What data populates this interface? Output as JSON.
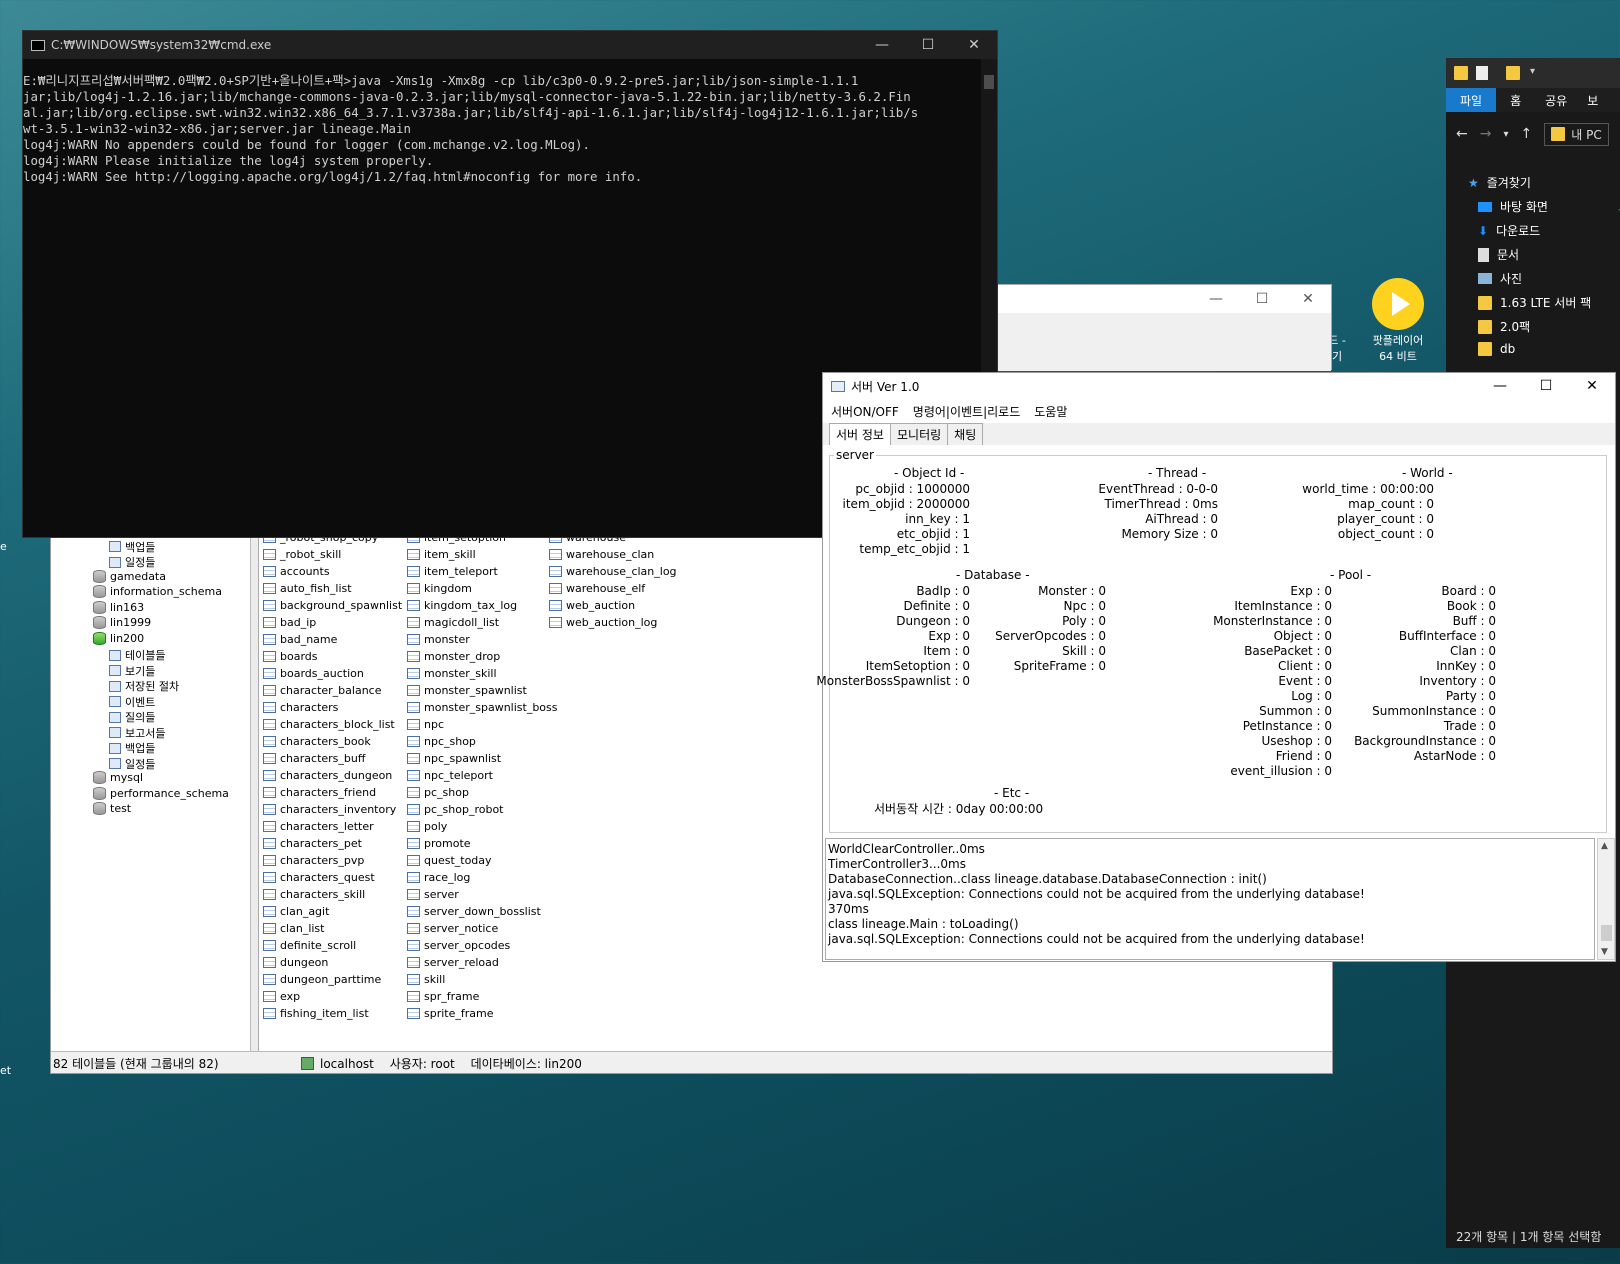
{
  "desktop": {
    "frag1": "e",
    "frag2": "et",
    "icon_label1": "팟플레이어",
    "icon_label2": "64 비트",
    "icon_label3": "드 -",
    "icon_label4": "기"
  },
  "cmd": {
    "title": "C:₩WINDOWS₩system32₩cmd.exe",
    "lines": [
      "E:₩리니지프리섭₩서버팩₩2.0팩₩2.0+SP기반+올나이트+팩>java -Xms1g -Xmx8g -cp lib/c3p0-0.9.2-pre5.jar;lib/json-simple-1.1.1",
      "jar;lib/log4j-1.2.16.jar;lib/mchange-commons-java-0.2.3.jar;lib/mysql-connector-java-5.1.22-bin.jar;lib/netty-3.6.2.Fin",
      "al.jar;lib/org.eclipse.swt.win32.win32.x86_64_3.7.1.v3738a.jar;lib/slf4j-api-1.6.1.jar;lib/slf4j-log4j12-1.6.1.jar;lib/s",
      "wt-3.5.1-win32-win32-x86.jar;server.jar lineage.Main",
      "log4j:WARN No appenders could be found for logger (com.mchange.v2.log.MLog).",
      "log4j:WARN Please initialize the log4j system properly.",
      "log4j:WARN See http://logging.apache.org/log4j/1.2/faq.html#noconfig for more info."
    ]
  },
  "mysql": {
    "tree": [
      {
        "label": "보고서들",
        "type": "report"
      },
      {
        "label": "백업들",
        "type": "backup"
      },
      {
        "label": "일정들",
        "type": "schedule"
      },
      {
        "label": "gamedata",
        "type": "db"
      },
      {
        "label": "information_schema",
        "type": "db"
      },
      {
        "label": "lin163",
        "type": "db"
      },
      {
        "label": "lin1999",
        "type": "db"
      },
      {
        "label": "lin200",
        "type": "db-open"
      },
      {
        "label": "테이블들",
        "type": "tables"
      },
      {
        "label": "보기들",
        "type": "views"
      },
      {
        "label": "저장된 절차",
        "type": "proc"
      },
      {
        "label": "이벤트",
        "type": "event"
      },
      {
        "label": "질의들",
        "type": "query"
      },
      {
        "label": "보고서들",
        "type": "report"
      },
      {
        "label": "백업들",
        "type": "backup"
      },
      {
        "label": "일정들",
        "type": "schedule"
      },
      {
        "label": "mysql",
        "type": "db"
      },
      {
        "label": "performance_schema",
        "type": "db"
      },
      {
        "label": "test",
        "type": "db"
      }
    ],
    "col1": [
      "_robot_shop_copy",
      "_robot_skill",
      "accounts",
      "auto_fish_list",
      "background_spawnlist",
      "bad_ip",
      "bad_name",
      "boards",
      "boards_auction",
      "character_balance",
      "characters",
      "characters_block_list",
      "characters_book",
      "characters_buff",
      "characters_dungeon",
      "characters_friend",
      "characters_inventory",
      "characters_letter",
      "characters_pet",
      "characters_pvp",
      "characters_quest",
      "characters_skill",
      "clan_agit",
      "clan_list",
      "definite_scroll",
      "dungeon",
      "dungeon_parttime",
      "exp",
      "fishing_item_list"
    ],
    "col2": [
      "item_setoption",
      "item_skill",
      "item_teleport",
      "kingdom",
      "kingdom_tax_log",
      "magicdoll_list",
      "monster",
      "monster_drop",
      "monster_skill",
      "monster_spawnlist",
      "monster_spawnlist_boss",
      "npc",
      "npc_shop",
      "npc_spawnlist",
      "npc_teleport",
      "pc_shop",
      "pc_shop_robot",
      "poly",
      "promote",
      "quest_today",
      "race_log",
      "server",
      "server_down_bosslist",
      "server_notice",
      "server_opcodes",
      "server_reload",
      "skill",
      "spr_frame",
      "sprite_frame"
    ],
    "col3": [
      "warehouse",
      "warehouse_clan",
      "warehouse_clan_log",
      "warehouse_elf",
      "web_auction",
      "web_auction_log"
    ],
    "status_count": "82 테이블들 (현재 그룹내의 82)",
    "status_host": "localhost",
    "status_user": "사용자: root",
    "status_db": "데이타베이스: lin200"
  },
  "server": {
    "title": "서버  Ver 1.0",
    "menu": [
      "서버ON/OFF",
      "명령어|이벤트|리로드",
      "도움말"
    ],
    "tabs": [
      "서버 정보",
      "모니터링",
      "채팅"
    ],
    "group": "server",
    "objectid_title": "- Object Id -",
    "objectid": [
      [
        "pc_objid",
        "1000000"
      ],
      [
        "item_objid",
        "2000000"
      ],
      [
        "inn_key",
        "1"
      ],
      [
        "etc_objid",
        "1"
      ],
      [
        "temp_etc_objid",
        "1"
      ]
    ],
    "thread_title": "- Thread -",
    "thread": [
      [
        "EventThread",
        "0-0-0"
      ],
      [
        "TimerThread",
        "0ms"
      ],
      [
        "AiThread",
        "0"
      ],
      [
        "Memory Size",
        "0"
      ]
    ],
    "world_title": "- World -",
    "world": [
      [
        "world_time",
        "00:00:00"
      ],
      [
        "map_count",
        "0"
      ],
      [
        "player_count",
        "0"
      ],
      [
        "object_count",
        "0"
      ]
    ],
    "database_title": "- Database -",
    "db1": [
      [
        "BadIp",
        "0"
      ],
      [
        "Definite",
        "0"
      ],
      [
        "Dungeon",
        "0"
      ],
      [
        "Exp",
        "0"
      ],
      [
        "Item",
        "0"
      ],
      [
        "ItemSetoption",
        "0"
      ],
      [
        "MonsterBossSpawnlist",
        "0"
      ]
    ],
    "db2": [
      [
        "Monster",
        "0"
      ],
      [
        "Npc",
        "0"
      ],
      [
        "Poly",
        "0"
      ],
      [
        "ServerOpcodes",
        "0"
      ],
      [
        "Skill",
        "0"
      ],
      [
        "SpriteFrame",
        "0"
      ]
    ],
    "pool_title": "- Pool -",
    "pool1": [
      [
        "Exp",
        "0"
      ],
      [
        "ItemInstance",
        "0"
      ],
      [
        "MonsterInstance",
        "0"
      ],
      [
        "Object",
        "0"
      ],
      [
        "BasePacket",
        "0"
      ],
      [
        "Client",
        "0"
      ],
      [
        "Event",
        "0"
      ],
      [
        "Log",
        "0"
      ],
      [
        "Summon",
        "0"
      ],
      [
        "PetInstance",
        "0"
      ],
      [
        "Useshop",
        "0"
      ],
      [
        "Friend",
        "0"
      ],
      [
        "event_illusion",
        "0"
      ]
    ],
    "pool2": [
      [
        "Board",
        "0"
      ],
      [
        "Book",
        "0"
      ],
      [
        "Buff",
        "0"
      ],
      [
        "BuffInterface",
        "0"
      ],
      [
        "Clan",
        "0"
      ],
      [
        "InnKey",
        "0"
      ],
      [
        "Inventory",
        "0"
      ],
      [
        "Party",
        "0"
      ],
      [
        "SummonInstance",
        "0"
      ],
      [
        "Trade",
        "0"
      ],
      [
        "BackgroundInstance",
        "0"
      ],
      [
        "AstarNode",
        "0"
      ]
    ],
    "etc_title": "- Etc -",
    "uptime": "서버동작 시간 : 0day 00:00:00",
    "log": [
      "WorldClearController..0ms",
      "TimerController3...0ms",
      "DatabaseConnection..class lineage.database.DatabaseConnection : init()",
      "java.sql.SQLException: Connections could not be acquired from the underlying database!",
      "370ms",
      "class lineage.Main : toLoading()",
      "java.sql.SQLException: Connections could not be acquired from the underlying database!"
    ]
  },
  "explorer": {
    "ribbon": [
      "파일",
      "홈",
      "공유",
      "보"
    ],
    "path": "내 PC",
    "items": [
      "즐겨찾기",
      "바탕 화면",
      "다운로드",
      "문서",
      "사진",
      "1.63 LTE 서버 팩",
      "2.0팩",
      "db"
    ],
    "status": "22개 항목  |  1개 항목 선택함"
  }
}
